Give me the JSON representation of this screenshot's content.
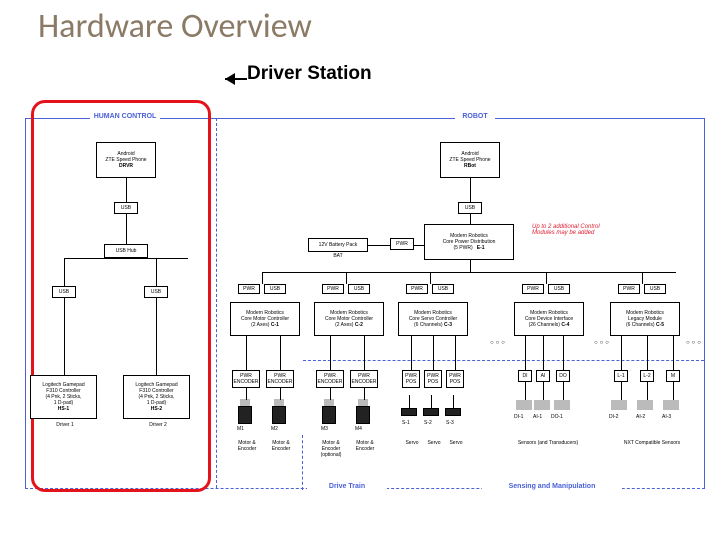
{
  "slide": {
    "title": "Hardware Overview",
    "subtitle": "Driver Station"
  },
  "sections": {
    "human": "HUMAN CONTROL",
    "robot": "ROBOT",
    "drive": "Drive Train",
    "sense": "Sensing and Manipulation"
  },
  "note": "Up to 2 additional Control Modules may be added",
  "labels": {
    "android": "Android",
    "zte": "ZTE Speed Phone",
    "drv": "DRVR",
    "usb": "USB",
    "usbhub": "USB Hub",
    "usbb": "USB",
    "usbc": "USB",
    "rbot": "RBot",
    "bat12": "12V Battery Pack",
    "bat": "BAT",
    "pwr": "PWR",
    "logitech": "Logitech Gamepad",
    "f310": "F310 Controller",
    "pad1": "(4 Pnk, 2 Sticks,",
    "pad2": "1 D-pad)",
    "hs1": "HS-1",
    "hs2": "HS-2",
    "d1": "Driver 1",
    "d2": "Driver 2",
    "mr": "Modern Robotics",
    "cpd": "Core Power Distribution",
    "e1": "E-1",
    "cpd2": "(5 PWR)",
    "cmc": "Core Motor Controller",
    "cmc2": "(2 Axes)",
    "c1": "C-1",
    "c2": "C-2",
    "csc": "Core Servo Controller",
    "csc2": "(6 Channels)",
    "c3": "C-3",
    "cdi": "Core Device Interface",
    "cdi2": "(26 Channels)",
    "c4": "C-4",
    "clm": "Legacy Module",
    "clm2": "(6 Channels)",
    "c5": "C-5",
    "pwrenc": "PWR",
    "enc": "ENCODER",
    "pos": "POS",
    "m": "M",
    "m1": "M1",
    "m2": "M2",
    "m3": "M3",
    "m4": "M4",
    "mtrX": "Motor &",
    "mtrY": "Encoder",
    "opt": "(optional)",
    "s1": "S-1",
    "s2": "S-2",
    "s3": "S-3",
    "servo": "Servo",
    "di": "DI",
    "ai": "AI",
    "do": "DO",
    "di1": "DI-1",
    "ai1": "AI-1",
    "do1": "DO-1",
    "di2": "DI-2",
    "ai2": "AI-2",
    "ai3": "AI-3",
    "ls1": "L-1",
    "ls2": "L-2",
    "sensAT": "Sensors (and Transducers)",
    "nxt": "NXT Compatible Sensors"
  },
  "chart_data": {
    "type": "table",
    "title": "FTC Hardware Block Diagram — highlighted region = Driver Station",
    "columns": [
      "id",
      "label",
      "parent",
      "category"
    ],
    "rows": [
      [
        "HUM",
        "HUMAN CONTROL",
        null,
        "zone"
      ],
      [
        "ROB",
        "ROBOT",
        null,
        "zone"
      ],
      [
        "DRVR",
        "Android ZTE Speed Phone DRVR",
        "HUM",
        "phone"
      ],
      [
        "RBOT",
        "Android ZTE Speed Phone RBot",
        "ROB",
        "phone"
      ],
      [
        "USB1",
        "USB",
        "DRVR",
        "bus"
      ],
      [
        "USB2",
        "USB",
        "RBOT",
        "bus"
      ],
      [
        "HUB",
        "USB Hub",
        "HUM",
        "hub"
      ],
      [
        "HS1",
        "Logitech Gamepad F310 HS-1",
        "HUB",
        "gamepad"
      ],
      [
        "HS2",
        "Logitech Gamepad F310 HS-2",
        "HUB",
        "gamepad"
      ],
      [
        "BAT",
        "12V Battery Pack BAT",
        "ROB",
        "power"
      ],
      [
        "E1",
        "Modern Robotics Core Power Distribution E-1",
        "ROB",
        "power-dist"
      ],
      [
        "C1",
        "Modern Robotics Core Motor Controller (2 Axes) C-1",
        "E1",
        "motor-ctrl"
      ],
      [
        "C2",
        "Modern Robotics Core Motor Controller (2 Axes) C-2",
        "E1",
        "motor-ctrl"
      ],
      [
        "C3",
        "Modern Robotics Core Servo Controller (6 Channels) C-3",
        "E1",
        "servo-ctrl"
      ],
      [
        "C4",
        "Modern Robotics Core Device Interface (26 Channels) C-4",
        "E1",
        "device-if"
      ],
      [
        "C5",
        "Modern Robotics Legacy Module (6 Channels) C-5",
        "E1",
        "legacy"
      ],
      [
        "M1",
        "M1 Motor & Encoder",
        "C1",
        "motor"
      ],
      [
        "M2",
        "M2 Motor & Encoder",
        "C1",
        "motor"
      ],
      [
        "M3",
        "M3 Motor & Encoder (optional)",
        "C2",
        "motor"
      ],
      [
        "M4",
        "M4 Motor & Encoder",
        "C2",
        "motor"
      ],
      [
        "S1",
        "S-1 Servo",
        "C3",
        "servo"
      ],
      [
        "S2",
        "S-2 Servo",
        "C3",
        "servo"
      ],
      [
        "S3",
        "S-3 Servo",
        "C3",
        "servo"
      ],
      [
        "DI1",
        "DI-1",
        "C4",
        "digital-in"
      ],
      [
        "AI1",
        "AI-1",
        "C4",
        "analog-in"
      ],
      [
        "DO1",
        "DO-1",
        "C4",
        "digital-out"
      ],
      [
        "DI2",
        "DI-2",
        "C5",
        "digital-in"
      ],
      [
        "AI2",
        "AI-2",
        "C5",
        "analog-in"
      ],
      [
        "AI3",
        "AI-3",
        "C5",
        "analog-in"
      ],
      [
        "DRV",
        "Drive Train",
        null,
        "zone"
      ],
      [
        "SNS",
        "Sensing and Manipulation",
        null,
        "zone"
      ]
    ]
  }
}
